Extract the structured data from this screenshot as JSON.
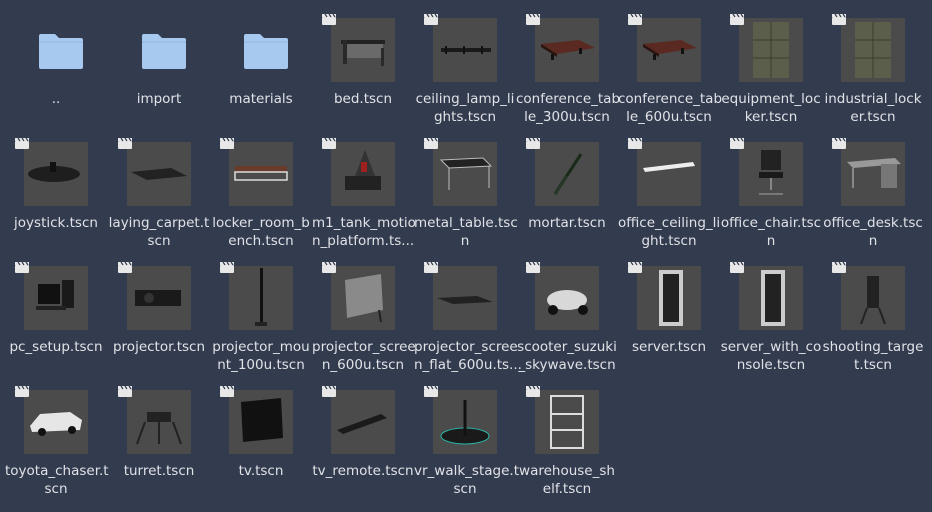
{
  "colors": {
    "background": "#333b4f",
    "folder": "#a7c9ef",
    "thumb_bg": "#4b4b4b",
    "text": "#e0e2e6"
  },
  "items": [
    {
      "type": "folder",
      "label": "..",
      "icon": "folder-icon"
    },
    {
      "type": "folder",
      "label": "import",
      "icon": "folder-icon"
    },
    {
      "type": "folder",
      "label": "materials",
      "icon": "folder-icon"
    },
    {
      "type": "scene",
      "label": "bed.tscn",
      "icon": "bed-preview"
    },
    {
      "type": "scene",
      "label": "ceiling_lamp_li\nghts.tscn",
      "icon": "ceiling-lamp-preview"
    },
    {
      "type": "scene",
      "label": "conference_tab\nle_300u.tscn",
      "icon": "conference-table-preview"
    },
    {
      "type": "scene",
      "label": "conference_tab\nle_600u.tscn",
      "icon": "conference-table-preview"
    },
    {
      "type": "scene",
      "label": "equipment_loc\nker.tscn",
      "icon": "locker-preview"
    },
    {
      "type": "scene",
      "label": "industrial_lock\ner.tscn",
      "icon": "locker-preview"
    },
    {
      "type": "scene",
      "label": "joystick.tscn",
      "icon": "joystick-preview"
    },
    {
      "type": "scene",
      "label": "laying_carpet.t\nscn",
      "icon": "carpet-preview"
    },
    {
      "type": "scene",
      "label": "locker_room_b\nench.tscn",
      "icon": "bench-preview"
    },
    {
      "type": "scene",
      "label": "m1_tank_motio\nn_platform.ts...",
      "icon": "platform-preview"
    },
    {
      "type": "scene",
      "label": "metal_table.tsc\nn",
      "icon": "table-preview"
    },
    {
      "type": "scene",
      "label": "mortar.tscn",
      "icon": "mortar-preview"
    },
    {
      "type": "scene",
      "label": "office_ceiling_li\nght.tscn",
      "icon": "ceiling-light-preview"
    },
    {
      "type": "scene",
      "label": "office_chair.tsc\nn",
      "icon": "chair-preview"
    },
    {
      "type": "scene",
      "label": "office_desk.tsc\nn",
      "icon": "desk-preview"
    },
    {
      "type": "scene",
      "label": "pc_setup.tscn",
      "icon": "pc-preview"
    },
    {
      "type": "scene",
      "label": "projector.tscn",
      "icon": "projector-preview"
    },
    {
      "type": "scene",
      "label": "projector_mou\nnt_100u.tscn",
      "icon": "mount-preview"
    },
    {
      "type": "scene",
      "label": "projector_scree\nn_600u.tscn",
      "icon": "screen-preview"
    },
    {
      "type": "scene",
      "label": "projector_scree\nn_flat_600u.ts...",
      "icon": "flat-screen-preview"
    },
    {
      "type": "scene",
      "label": "scooter_suzuki\n_skywave.tscn",
      "icon": "scooter-preview"
    },
    {
      "type": "scene",
      "label": "server.tscn",
      "icon": "server-preview"
    },
    {
      "type": "scene",
      "label": "server_with_co\nnsole.tscn",
      "icon": "server-preview"
    },
    {
      "type": "scene",
      "label": "shooting_targe\nt.tscn",
      "icon": "target-preview"
    },
    {
      "type": "scene",
      "label": "toyota_chaser.t\nscn",
      "icon": "car-preview"
    },
    {
      "type": "scene",
      "label": "turret.tscn",
      "icon": "turret-preview"
    },
    {
      "type": "scene",
      "label": "tv.tscn",
      "icon": "tv-preview"
    },
    {
      "type": "scene",
      "label": "tv_remote.tscn",
      "icon": "remote-preview"
    },
    {
      "type": "scene",
      "label": "vr_walk_stage.t\nscn",
      "icon": "vr-stage-preview"
    },
    {
      "type": "scene",
      "label": "warehouse_sh\nelf.tscn",
      "icon": "shelf-preview"
    }
  ]
}
